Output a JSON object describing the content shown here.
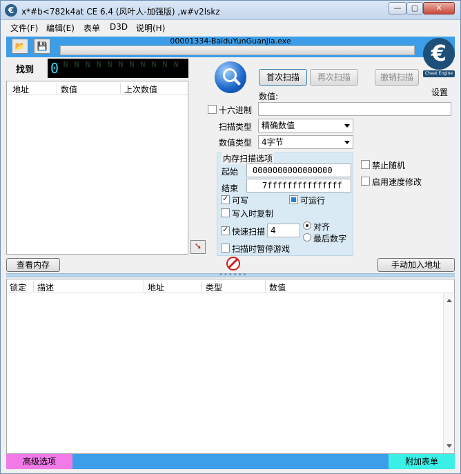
{
  "window": {
    "title": "x*#b<782k4at  CE 6.4 (风叶人-加强版) ,w#v2lskz",
    "icon_label": "€",
    "minimize": "—",
    "maximize": "▢",
    "close": "✕"
  },
  "menu": [
    {
      "label": "文件(F)"
    },
    {
      "label": "编辑(E)"
    },
    {
      "label": "表单"
    },
    {
      "label": "D3D"
    },
    {
      "label": "说明(H)"
    }
  ],
  "toolbar": {
    "open_icon": "📂",
    "save_icon": "💾",
    "process_name": "00001334-BaiduYunGuanjia.exe",
    "colors": {
      "strip": "#3c9ee8"
    }
  },
  "logo": {
    "glyph": "€",
    "sub": "Cheat Engine",
    "settings_label": "设置"
  },
  "found": {
    "label": "找到",
    "lit_digit": "0",
    "dim_digit": "N"
  },
  "results_list": {
    "columns": [
      "地址",
      "数值",
      "上次数值"
    ]
  },
  "scan": {
    "first_scan": "首次扫描",
    "next_scan": "再次扫描",
    "undo_scan": "撤销扫描",
    "value_label": "数值:",
    "value": "",
    "hex_label": "十六进制",
    "scan_type_label": "扫描类型",
    "scan_type_value": "精确数值",
    "value_type_label": "数值类型",
    "value_type_value": "4字节"
  },
  "memory_options": {
    "title": "内存扫描选项",
    "start_label": "起始",
    "start_value": "0000000000000000",
    "end_label": "结束",
    "end_value": "7fffffffffffffff",
    "writable_label": "可写",
    "executable_label": "可运行",
    "copy_on_write_label": "写入时复制",
    "fast_scan_label": "快速扫描",
    "fast_scan_value": "4",
    "align_label": "对齐",
    "last_digits_label": "最后数字",
    "pause_label": "扫描时暂停游戏"
  },
  "extra_options": {
    "no_random_label": "禁止随机",
    "speedhack_label": "启用速度修改"
  },
  "buttons": {
    "view_memory": "查看内存",
    "add_address_manual": "手动加入地址"
  },
  "splitter": {
    "dots": "••••••"
  },
  "address_table": {
    "columns": [
      "锁定",
      "描述",
      "地址",
      "类型",
      "数值"
    ]
  },
  "bottom": {
    "advanced": "高级选项",
    "add_table": "附加表单",
    "colors": {
      "advanced": "#f27ae8",
      "add_table": "#3bf0e6"
    }
  }
}
